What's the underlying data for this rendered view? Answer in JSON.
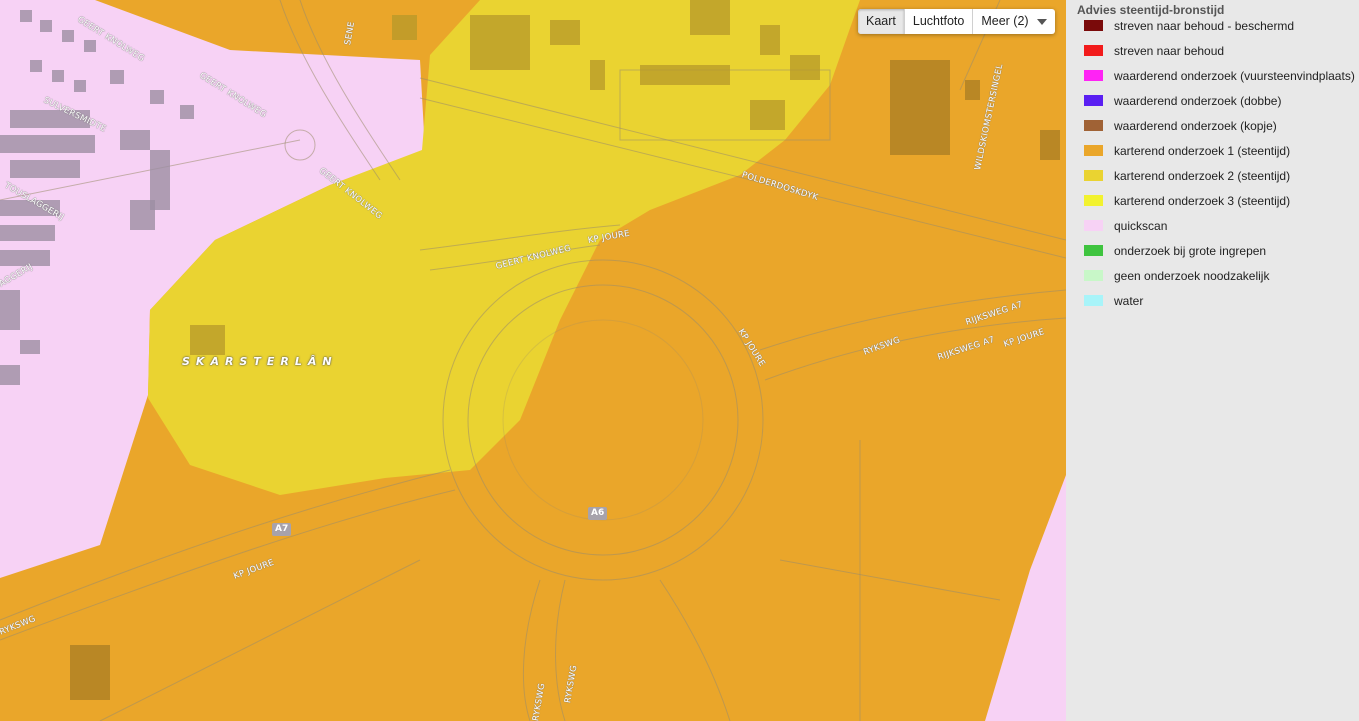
{
  "map": {
    "place_label": "SKARSTERLÂN",
    "street_labels": [
      "GEERT KNOLWEG",
      "GEERT KNOLWEG",
      "SULVERSMIDTE",
      "TOUSLAGGERIJ",
      "AGGERIJ",
      "SENE",
      "GEERT KNOLWEG",
      "GEERT KNOLWEG",
      "KP JOURE",
      "POLDERDOSKDYK",
      "WILDSKIOMSTERSINGEL",
      "KP JOURE",
      "RYKSWG",
      "RIJKSWEG A7",
      "RIJKSWEG A7",
      "KP JOURE",
      "KP JOURE",
      "RYKSWG",
      "RYKSWG",
      "RYKSWG"
    ],
    "shields": [
      "A7",
      "A6"
    ],
    "zone_colors": {
      "base": "#eaa62a",
      "karterend_2": "#ead331",
      "quickscan": "#f7d2f5"
    }
  },
  "map_type": {
    "buttons": [
      "Kaart",
      "Luchtfoto",
      "Meer (2)"
    ],
    "active": "Kaart"
  },
  "legend": {
    "title": "Advies steentijd-bronstijd",
    "items": [
      {
        "label": "streven naar behoud - beschermd",
        "color": "#7a0a0a"
      },
      {
        "label": "streven naar behoud",
        "color": "#f21b1b"
      },
      {
        "label": "waarderend onderzoek (vuursteenvindplaats)",
        "color": "#ff23f5"
      },
      {
        "label": "waarderend onderzoek (dobbe)",
        "color": "#5a1ff2"
      },
      {
        "label": "waarderend onderzoek (kopje)",
        "color": "#a06235"
      },
      {
        "label": "karterend onderzoek 1 (steentijd)",
        "color": "#eaa62a"
      },
      {
        "label": "karterend onderzoek 2 (steentijd)",
        "color": "#ead331"
      },
      {
        "label": "karterend onderzoek 3 (steentijd)",
        "color": "#f2f22f"
      },
      {
        "label": "quickscan",
        "color": "#f7d2f5"
      },
      {
        "label": "onderzoek bij grote ingrepen",
        "color": "#3fc43f"
      },
      {
        "label": "geen onderzoek noodzakelijk",
        "color": "#c8f7c8"
      },
      {
        "label": "water",
        "color": "#a8f4f9"
      }
    ]
  }
}
